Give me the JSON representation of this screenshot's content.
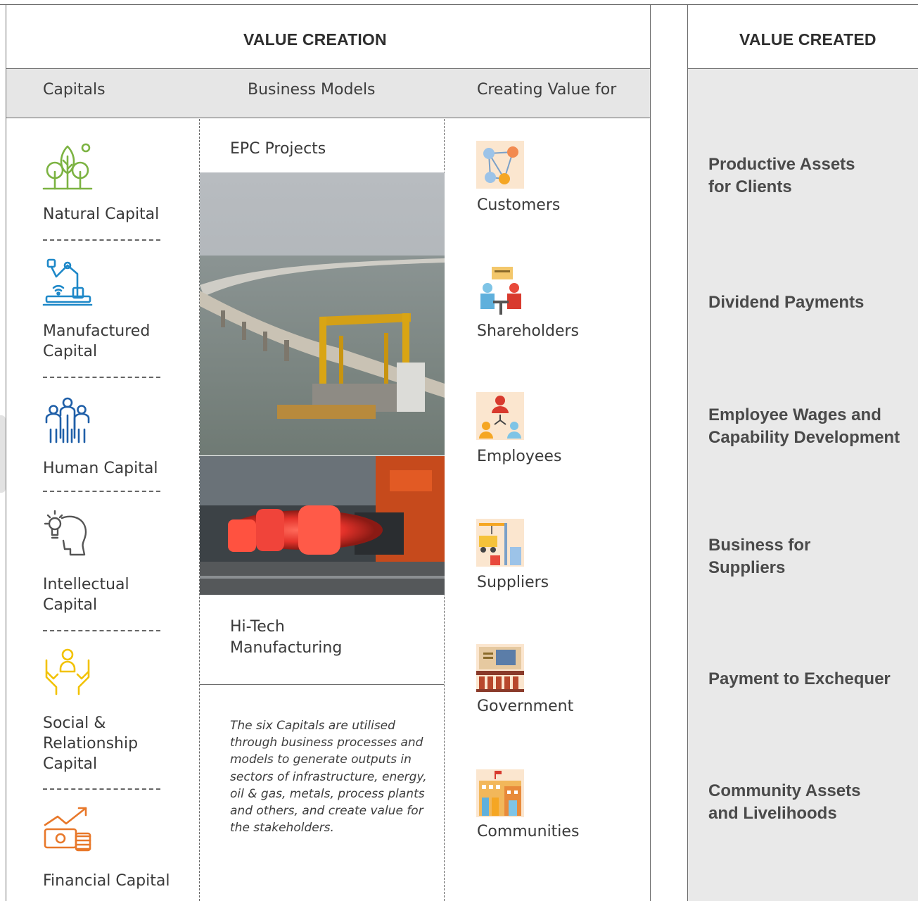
{
  "header": {
    "value_creation": "VALUE CREATION",
    "value_created": "VALUE CREATED"
  },
  "subheader": {
    "capitals": "Capitals",
    "business_models": "Business Models",
    "creating_value_for": "Creating Value for"
  },
  "capitals": [
    {
      "label": "Natural Capital",
      "icon": "trees-icon",
      "color": "#7cb342"
    },
    {
      "label": "Manufactured Capital",
      "icon": "robot-arm-icon",
      "color": "#1e88c8"
    },
    {
      "label": "Human Capital",
      "icon": "people-icon",
      "color": "#1f5fa8"
    },
    {
      "label": "Intellectual Capital",
      "icon": "lightbulb-head-icon",
      "color": "#555555"
    },
    {
      "label": "Social & Relationship Capital",
      "icon": "hands-person-icon",
      "color": "#f2c200"
    },
    {
      "label": "Financial Capital",
      "icon": "money-growth-icon",
      "color": "#e8782a"
    }
  ],
  "business_models": {
    "epc": "EPC Projects",
    "hitech": "Hi-Tech Manufacturing",
    "note": "The six Capitals are utilised through business processes and models to generate outputs in sectors of infrastructure, energy, oil & gas, metals, process plants and others, and create value for the stakeholders."
  },
  "stakeholders": [
    {
      "label": "Customers",
      "icon": "network-people-icon"
    },
    {
      "label": "Shareholders",
      "icon": "meeting-icon"
    },
    {
      "label": "Employees",
      "icon": "team-hierarchy-icon"
    },
    {
      "label": "Suppliers",
      "icon": "crane-truck-icon"
    },
    {
      "label": "Government",
      "icon": "government-building-icon"
    },
    {
      "label": "Communities",
      "icon": "town-buildings-icon"
    }
  ],
  "value_created": [
    "Productive Assets for Clients",
    "Dividend Payments",
    "Employee Wages and Capability Development",
    "Business for Suppliers",
    "Payment to Exchequer",
    "Community Assets and Livelihoods"
  ]
}
